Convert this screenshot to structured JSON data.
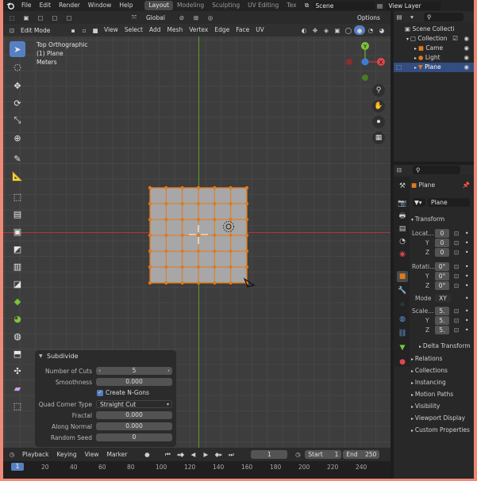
{
  "topbar": {
    "menus": [
      "File",
      "Edit",
      "Render",
      "Window",
      "Help"
    ],
    "workspaces": [
      "Layout",
      "Modeling",
      "Sculpting",
      "UV Editing",
      "Tex"
    ],
    "active_workspace": "Layout",
    "scene": "Scene",
    "view_layer": "View Layer"
  },
  "viewport_header": {
    "mode": "Edit Mode",
    "menus": [
      "View",
      "Select",
      "Add",
      "Mesh",
      "Vertex",
      "Edge",
      "Face",
      "UV"
    ],
    "orientation": "Global",
    "options": "Options"
  },
  "overlay_text": {
    "view_name": "Top Orthographic",
    "object_name": "(1) Plane",
    "units": "Meters"
  },
  "gizmo": {
    "y": "Y",
    "x": "X"
  },
  "outliner": {
    "title": "Scene Collecti",
    "rows": [
      {
        "label": "Collection",
        "selected": false
      },
      {
        "label": "Came",
        "selected": false
      },
      {
        "label": "Light",
        "selected": false
      },
      {
        "label": "Plane",
        "selected": true
      }
    ]
  },
  "properties": {
    "object_label": "Plane",
    "mesh_name": "Plane",
    "transform_title": "Transform",
    "location_label": "Locat...",
    "location": [
      "0",
      "0",
      "0"
    ],
    "rotation_label": "Rotati...",
    "rotation": [
      "0°",
      "0°",
      "0°"
    ],
    "mode_label": "Mode",
    "mode_value": "XY",
    "scale_label": "Scale...",
    "scale": [
      "5.",
      "5.",
      "5."
    ],
    "axis": [
      "X",
      "Y",
      "Z"
    ],
    "delta_transform": "Delta Transform",
    "sections": [
      "Relations",
      "Collections",
      "Instancing",
      "Motion Paths",
      "Visibility",
      "Viewport Display",
      "Custom Properties"
    ]
  },
  "operator_panel": {
    "title": "Subdivide",
    "number_of_cuts_label": "Number of Cuts",
    "number_of_cuts": "5",
    "smoothness_label": "Smoothness",
    "smoothness": "0.000",
    "create_ngons": "Create N-Gons",
    "create_ngons_checked": true,
    "quad_corner_label": "Quad Corner Type",
    "quad_corner": "Straight Cut",
    "fractal_label": "Fractal",
    "fractal": "0.000",
    "along_normal_label": "Along Normal",
    "along_normal": "0.000",
    "random_seed_label": "Random Seed",
    "random_seed": "0"
  },
  "timeline": {
    "menus": [
      "Playback",
      "Keying",
      "View",
      "Marker"
    ],
    "current_frame": "1",
    "start_label": "Start",
    "start": "1",
    "end_label": "End",
    "end": "250",
    "ruler": [
      "1",
      "20",
      "40",
      "60",
      "80",
      "100",
      "120",
      "140",
      "160",
      "180",
      "200",
      "220",
      "240"
    ]
  },
  "colors": {
    "accent": "#5680c2",
    "viewport_bg": "#3d3d3d",
    "mesh_face": "#a7a7a7",
    "mesh_edge": "#e07a1c",
    "x_axis": "#b5333b",
    "y_axis": "#5e9c2a"
  }
}
